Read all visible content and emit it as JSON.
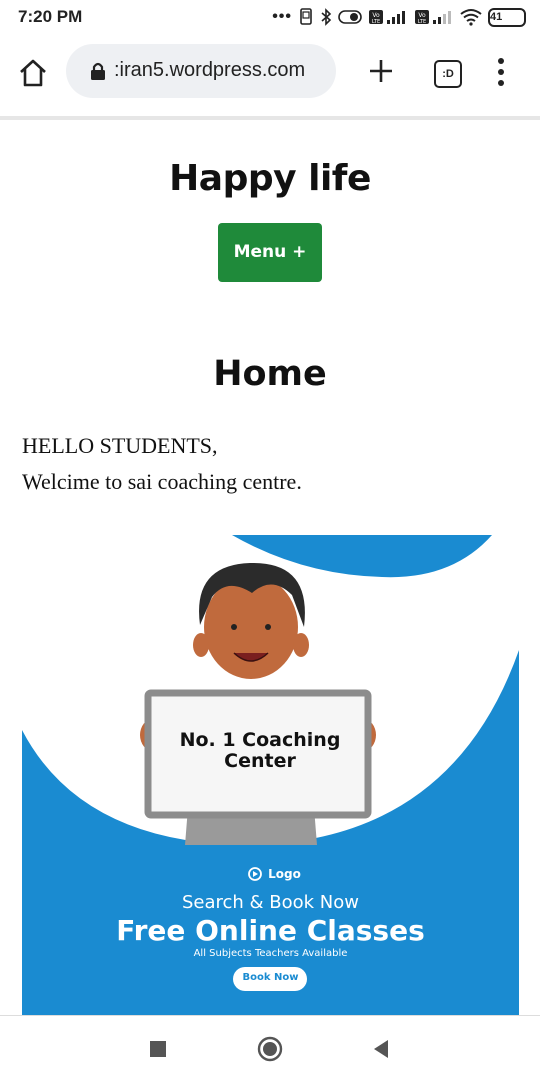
{
  "status_bar": {
    "time": "7:20 PM",
    "battery": "41",
    "icons": [
      "dots-icon",
      "screenshot-icon",
      "bluetooth-icon",
      "toggle-icon",
      "volte-signal-icon",
      "volte-signal-icon",
      "wifi-icon",
      "battery-icon"
    ]
  },
  "browser": {
    "url": ":iran5.wordpress.com",
    "tabs_label": ":D",
    "icons": [
      "home-icon",
      "lock-icon",
      "plus-icon",
      "tabs-icon",
      "more-vert-icon"
    ]
  },
  "site": {
    "title": "Happy life",
    "menu_label": "Menu +",
    "menu_color": "#1f8a3a"
  },
  "page": {
    "heading": "Home",
    "lines": [
      "HELLO STUDENTS,",
      "Welcime to sai coaching centre."
    ]
  },
  "promo": {
    "board_line1": "No. 1 Coaching",
    "board_line2": "Center",
    "logo": "Logo",
    "tagline": "Search & Book Now",
    "headline": "Free Online Classes",
    "subtext": "All Subjects Teachers Available",
    "button": "Book Now",
    "blue": "#1a8bd1"
  },
  "nav": {
    "icons": [
      "recents-square-icon",
      "home-circle-icon",
      "back-triangle-icon"
    ]
  }
}
